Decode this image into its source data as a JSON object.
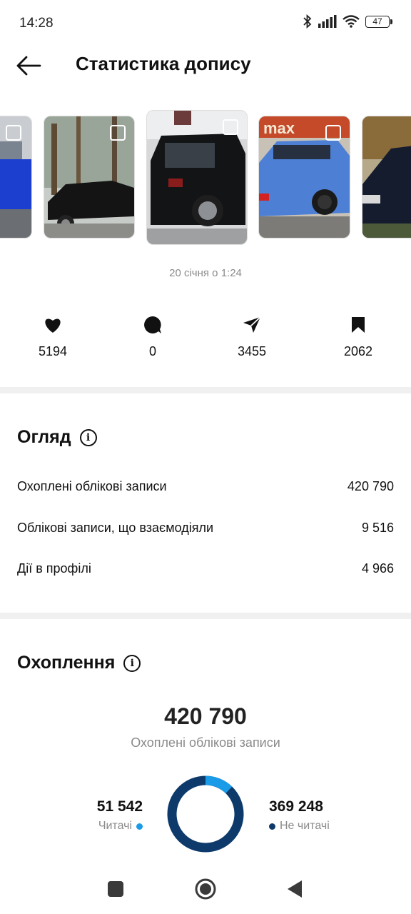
{
  "status_bar": {
    "time": "14:28",
    "battery": "47"
  },
  "header": {
    "title": "Статистика допису"
  },
  "post": {
    "date": "20 січня о 1:24"
  },
  "metrics": {
    "likes": "5194",
    "comments": "0",
    "shares": "3455",
    "saves": "2062"
  },
  "overview": {
    "title": "Огляд",
    "rows": [
      {
        "label": "Охоплені облікові записи",
        "value": "420 790"
      },
      {
        "label": "Облікові записи, що взаємодіяли",
        "value": "9 516"
      },
      {
        "label": "Дії в профілі",
        "value": "4 966"
      }
    ]
  },
  "reach": {
    "title": "Охоплення",
    "total": "420 790",
    "total_label": "Охоплені облікові записи",
    "followers": {
      "value": "51 542",
      "label": "Читачі",
      "color": "#1a9be8"
    },
    "non_followers": {
      "value": "369 248",
      "label": "Не читачі",
      "color": "#0d3a6b"
    },
    "followers_fraction": 0.1225
  },
  "icons": [
    "back-arrow-icon",
    "bluetooth-icon",
    "signal-icon",
    "wifi-icon",
    "heart-icon",
    "comment-icon",
    "send-icon",
    "bookmark-icon",
    "info-icon",
    "nav-recent-icon",
    "nav-home-icon",
    "nav-back-icon"
  ]
}
